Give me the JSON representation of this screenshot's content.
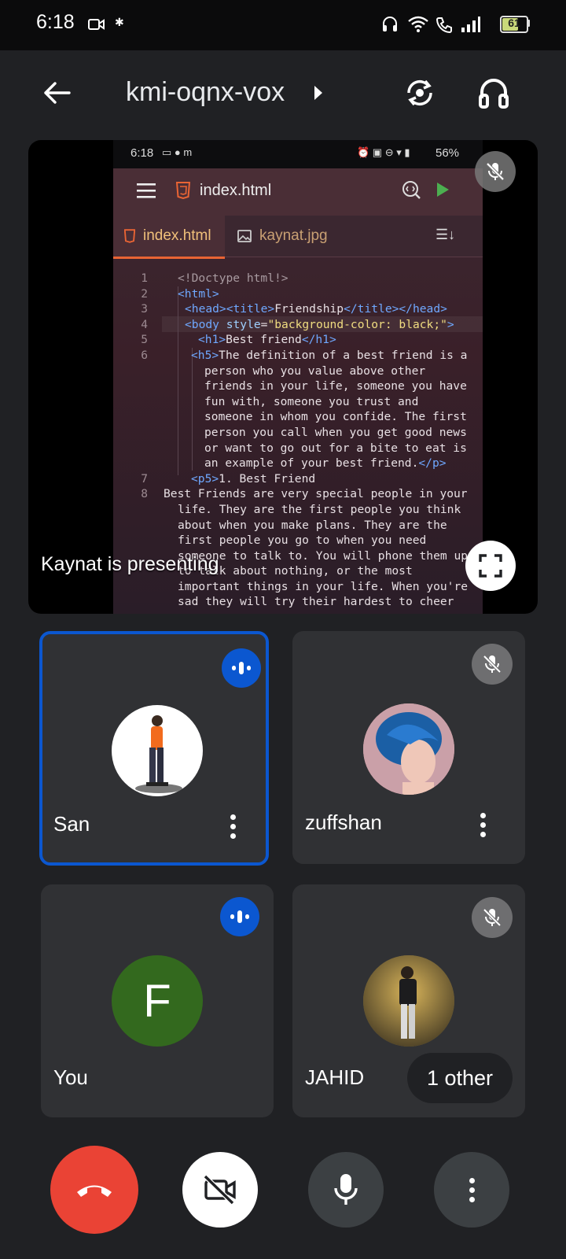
{
  "status_bar": {
    "time": "6:18",
    "battery": "61"
  },
  "header": {
    "meeting_code": "kmi-oqnx-vox"
  },
  "presentation": {
    "caption": "Kaynat is presenting",
    "screen": {
      "time": "6:18",
      "battery": "56%",
      "file_title": "index.html",
      "tabs": [
        "index.html",
        "kaynat.jpg"
      ],
      "line_numbers": [
        "1",
        "2",
        "3",
        "4",
        "5",
        "6",
        "7",
        "8"
      ]
    }
  },
  "participants": [
    {
      "name": "San",
      "state": "speaking"
    },
    {
      "name": "zuffshan",
      "state": "muted"
    },
    {
      "name": "You",
      "initial": "F",
      "state": "speaking"
    },
    {
      "name": "JAHID",
      "state": "muted",
      "badge": "1 other"
    }
  ],
  "colors": {
    "hangup": "#ea4335",
    "speaking": "#0b57d0",
    "active_border": "#0b57d0",
    "you_avatar": "#33691e"
  }
}
